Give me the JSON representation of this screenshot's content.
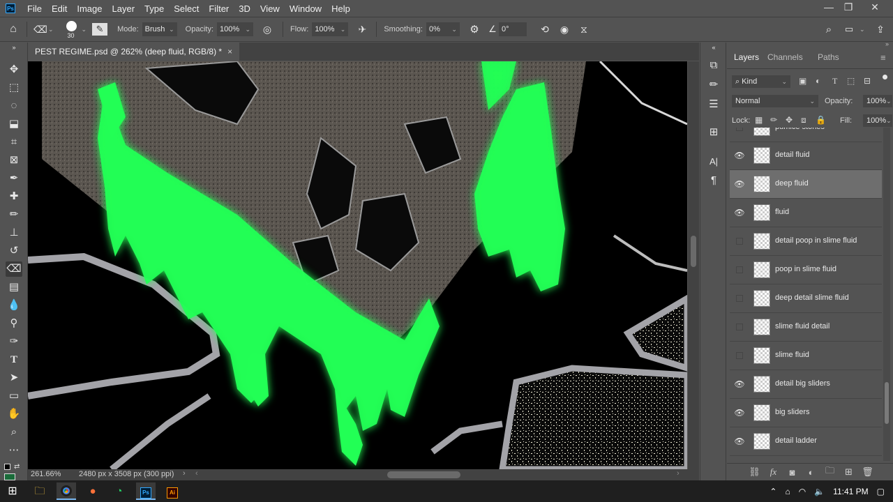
{
  "app": {
    "logo_text": "Ps"
  },
  "menu": [
    "File",
    "Edit",
    "Image",
    "Layer",
    "Type",
    "Select",
    "Filter",
    "3D",
    "View",
    "Window",
    "Help"
  ],
  "window_controls": {
    "minimize": "—",
    "restore": "❐",
    "close": "✕"
  },
  "options_bar": {
    "brush_size": "30",
    "mode_label": "Mode:",
    "mode_value": "Brush",
    "opacity_label": "Opacity:",
    "opacity_value": "100%",
    "flow_label": "Flow:",
    "flow_value": "100%",
    "smoothing_label": "Smoothing:",
    "smoothing_value": "0%",
    "angle_value": "0°"
  },
  "document": {
    "tab_title": "PEST REGIME.psd @ 262% (deep fluid, RGB/8) *",
    "close_glyph": "×",
    "zoom": "261.66%",
    "doc_info": "2480 px x 3508 px (300 ppi)"
  },
  "panel": {
    "tabs": [
      "Layers",
      "Channels",
      "Paths"
    ],
    "filter_kind": "Kind",
    "blend_mode": "Normal",
    "opacity_label": "Opacity:",
    "opacity_value": "100%",
    "lock_label": "Lock:",
    "fill_label": "Fill:",
    "fill_value": "100%",
    "layers": [
      {
        "name": "pumice stones",
        "visible": false,
        "selected": false
      },
      {
        "name": "detail fluid",
        "visible": true,
        "selected": false
      },
      {
        "name": "deep fluid",
        "visible": true,
        "selected": true
      },
      {
        "name": "fluid",
        "visible": true,
        "selected": false
      },
      {
        "name": "detail poop in slime fluid",
        "visible": false,
        "selected": false
      },
      {
        "name": "poop in slime fluid",
        "visible": false,
        "selected": false
      },
      {
        "name": "deep detail slime fluid",
        "visible": false,
        "selected": false
      },
      {
        "name": "slime fluid detail",
        "visible": false,
        "selected": false
      },
      {
        "name": "slime fluid",
        "visible": false,
        "selected": false
      },
      {
        "name": "detail big sliders",
        "visible": true,
        "selected": false
      },
      {
        "name": "big sliders",
        "visible": true,
        "selected": false
      },
      {
        "name": "detail ladder",
        "visible": true,
        "selected": false
      }
    ]
  },
  "taskbar": {
    "time": "11:41 PM"
  },
  "colors": {
    "slime_green": "#22ff55",
    "canvas_bg": "#000000",
    "ui_panel": "#535353"
  }
}
